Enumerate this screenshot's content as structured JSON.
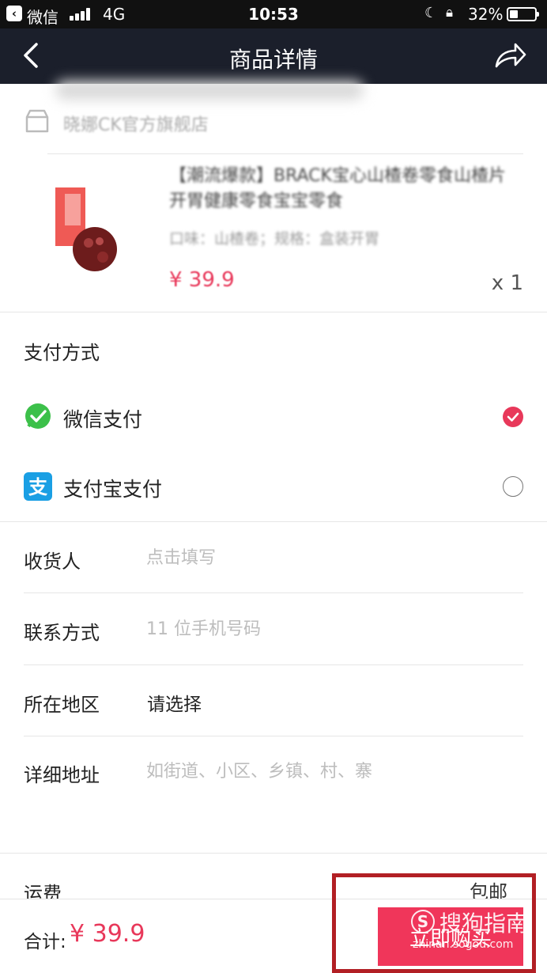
{
  "status_bar": {
    "back_app_label": "微信",
    "network": "4G",
    "time": "10:53",
    "battery": "32%"
  },
  "nav": {
    "title": "商品详情",
    "back_icon": "chevron-left-icon",
    "share_icon": "share-arrow-icon"
  },
  "store": {
    "name": "晓娜CK官方旗舰店"
  },
  "product": {
    "name": "【潮流爆款】BRACK宝心山楂卷零食山楂片开胃健康零食宝宝零食",
    "spec": "口味：山楂卷；规格：盒装开胃",
    "price": "¥ 39.9",
    "quantity": "x 1"
  },
  "payment": {
    "title": "支付方式",
    "options": [
      {
        "label": "微信支付",
        "icon": "wechat-pay-icon",
        "selected": true
      },
      {
        "label": "支付宝支付",
        "icon": "alipay-icon",
        "selected": false
      }
    ]
  },
  "form": {
    "recipient": {
      "label": "收货人",
      "placeholder": "点击填写"
    },
    "contact": {
      "label": "联系方式",
      "placeholder": "11 位手机号码"
    },
    "region": {
      "label": "所在地区",
      "value": "请选择"
    },
    "address": {
      "label": "详细地址",
      "placeholder": "如街道、小区、乡镇、村、寨"
    }
  },
  "freight": {
    "label": "运费",
    "value": "包邮"
  },
  "footer": {
    "total_label": "合计:",
    "total_value": "¥ 39.9",
    "buy_label": "立即购买"
  },
  "watermark": {
    "logo": "S",
    "text": "搜狗指南",
    "url": "zhinan.sogou.com"
  },
  "colors": {
    "accent": "#e8385a",
    "nav_bg": "#1b1f2b",
    "highlight": "#b21f24"
  }
}
